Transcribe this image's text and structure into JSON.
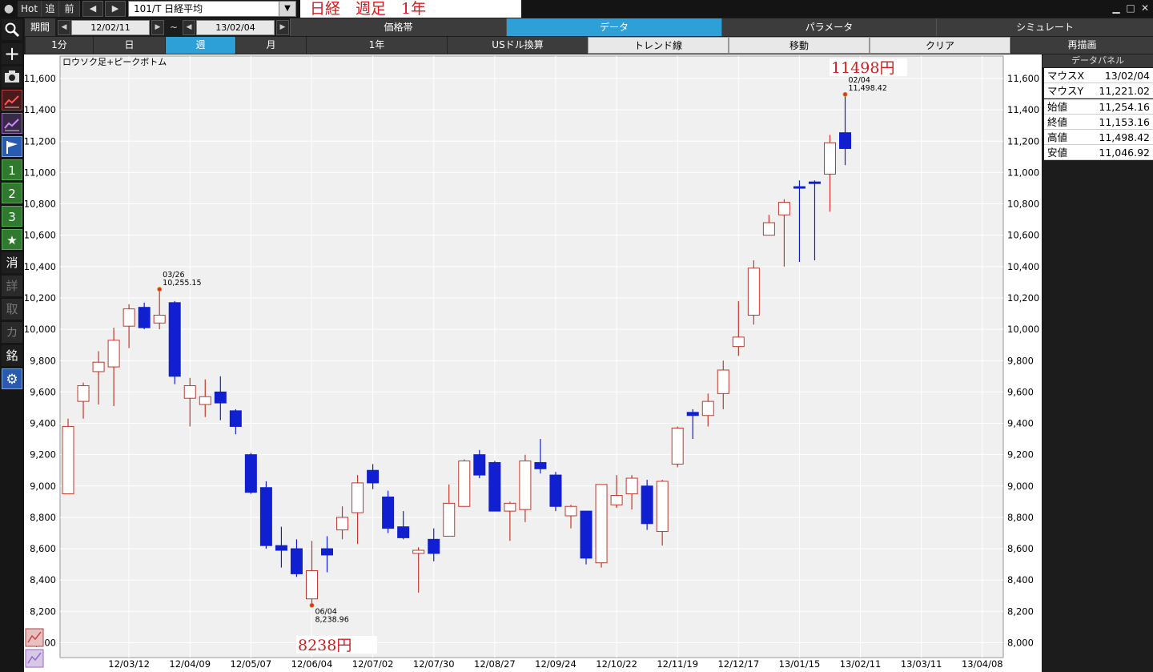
{
  "titlebar": {
    "hot": "Hot",
    "next": "追",
    "prev": "前",
    "symbol": "101/T 日経平均",
    "headline": "日経　週足　1年"
  },
  "toolbar_left": [
    "1",
    "2",
    "3",
    "★",
    "消",
    "詳",
    "取",
    "カ",
    "銘"
  ],
  "period": {
    "label": "期間",
    "start": "12/02/11",
    "tilde": "~",
    "end": "13/02/04",
    "tabs": [
      "価格帯",
      "データ",
      "パラメータ",
      "シミュレート"
    ],
    "selected_tab": "データ"
  },
  "timeframes": {
    "items": [
      "1分",
      "日",
      "週",
      "月",
      "1年",
      "USドル換算",
      "トレンド線",
      "移動",
      "クリア",
      "再描画"
    ],
    "selected": "週"
  },
  "chart_data": {
    "type": "candlestick",
    "title": "ロウソク足+ピークボトム",
    "ylim": [
      7920,
      11800
    ],
    "y_ticks": [
      8000,
      8200,
      8400,
      8600,
      8800,
      9000,
      9200,
      9400,
      9600,
      9800,
      10000,
      10200,
      10400,
      10600,
      10800,
      11000,
      11200,
      11400,
      11600
    ],
    "y_tick_labels": [
      "8,000",
      "8,200",
      "8,400",
      "8,600",
      "8,800",
      "9,000",
      "9,200",
      "9,400",
      "9,600",
      "9,800",
      "10,000",
      "10,200",
      "10,400",
      "10,600",
      "10,800",
      "11,000",
      "11,200",
      "11,400",
      "11,600"
    ],
    "x_ticks": [
      {
        "label": "12/03/12",
        "index": 4
      },
      {
        "label": "12/04/09",
        "index": 8
      },
      {
        "label": "12/05/07",
        "index": 12
      },
      {
        "label": "12/06/04",
        "index": 16
      },
      {
        "label": "12/07/02",
        "index": 20
      },
      {
        "label": "12/07/30",
        "index": 24
      },
      {
        "label": "12/08/27",
        "index": 28
      },
      {
        "label": "12/09/24",
        "index": 32
      },
      {
        "label": "12/10/22",
        "index": 36
      },
      {
        "label": "12/11/19",
        "index": 40
      },
      {
        "label": "12/12/17",
        "index": 44
      },
      {
        "label": "13/01/15",
        "index": 48
      },
      {
        "label": "13/02/11",
        "index": 52
      },
      {
        "label": "13/03/11",
        "index": 56
      },
      {
        "label": "13/04/08",
        "index": 60
      }
    ],
    "bull_color": "#c0392b",
    "bear_color": "#1020d0",
    "candles": [
      {
        "o": 8950,
        "h": 9430,
        "l": 8950,
        "c": 9380
      },
      {
        "o": 9540,
        "h": 9660,
        "l": 9430,
        "c": 9640
      },
      {
        "o": 9730,
        "h": 9860,
        "l": 9520,
        "c": 9790
      },
      {
        "o": 9760,
        "h": 10010,
        "l": 9510,
        "c": 9930
      },
      {
        "o": 10020,
        "h": 10160,
        "l": 9880,
        "c": 10130
      },
      {
        "o": 10140,
        "h": 10170,
        "l": 10000,
        "c": 10010
      },
      {
        "o": 10040,
        "h": 10255.15,
        "l": 10000,
        "c": 10090
      },
      {
        "o": 10170,
        "h": 10180,
        "l": 9650,
        "c": 9700
      },
      {
        "o": 9560,
        "h": 9690,
        "l": 9380,
        "c": 9640
      },
      {
        "o": 9520,
        "h": 9680,
        "l": 9440,
        "c": 9570
      },
      {
        "o": 9600,
        "h": 9700,
        "l": 9420,
        "c": 9530
      },
      {
        "o": 9480,
        "h": 9490,
        "l": 9330,
        "c": 9380
      },
      {
        "o": 9200,
        "h": 9210,
        "l": 8950,
        "c": 8960
      },
      {
        "o": 8990,
        "h": 9030,
        "l": 8600,
        "c": 8620
      },
      {
        "o": 8620,
        "h": 8740,
        "l": 8480,
        "c": 8590
      },
      {
        "o": 8600,
        "h": 8660,
        "l": 8420,
        "c": 8440
      },
      {
        "o": 8280,
        "h": 8650,
        "l": 8238.96,
        "c": 8460
      },
      {
        "o": 8600,
        "h": 8680,
        "l": 8450,
        "c": 8560
      },
      {
        "o": 8720,
        "h": 8870,
        "l": 8660,
        "c": 8800
      },
      {
        "o": 8830,
        "h": 9070,
        "l": 8630,
        "c": 9020
      },
      {
        "o": 9100,
        "h": 9140,
        "l": 8980,
        "c": 9020
      },
      {
        "o": 8930,
        "h": 8970,
        "l": 8700,
        "c": 8730
      },
      {
        "o": 8740,
        "h": 8840,
        "l": 8660,
        "c": 8670
      },
      {
        "o": 8570,
        "h": 8610,
        "l": 8320,
        "c": 8590
      },
      {
        "o": 8660,
        "h": 8730,
        "l": 8520,
        "c": 8570
      },
      {
        "o": 8680,
        "h": 9010,
        "l": 8680,
        "c": 8890
      },
      {
        "o": 8870,
        "h": 9170,
        "l": 8870,
        "c": 9160
      },
      {
        "o": 9200,
        "h": 9230,
        "l": 9050,
        "c": 9070
      },
      {
        "o": 9150,
        "h": 9160,
        "l": 8840,
        "c": 8840
      },
      {
        "o": 8840,
        "h": 8900,
        "l": 8650,
        "c": 8890
      },
      {
        "o": 8850,
        "h": 9200,
        "l": 8770,
        "c": 9160
      },
      {
        "o": 9150,
        "h": 9300,
        "l": 9080,
        "c": 9110
      },
      {
        "o": 9070,
        "h": 9090,
        "l": 8840,
        "c": 8870
      },
      {
        "o": 8810,
        "h": 8880,
        "l": 8730,
        "c": 8870
      },
      {
        "o": 8840,
        "h": 8840,
        "l": 8500,
        "c": 8540
      },
      {
        "o": 8510,
        "h": 9010,
        "l": 8480,
        "c": 9010
      },
      {
        "o": 8880,
        "h": 9070,
        "l": 8860,
        "c": 8940
      },
      {
        "o": 8950,
        "h": 9070,
        "l": 8850,
        "c": 9050
      },
      {
        "o": 9000,
        "h": 9040,
        "l": 8720,
        "c": 8760
      },
      {
        "o": 8710,
        "h": 9040,
        "l": 8620,
        "c": 9030
      },
      {
        "o": 9140,
        "h": 9380,
        "l": 9120,
        "c": 9370
      },
      {
        "o": 9470,
        "h": 9490,
        "l": 9300,
        "c": 9450
      },
      {
        "o": 9450,
        "h": 9590,
        "l": 9380,
        "c": 9540
      },
      {
        "o": 9590,
        "h": 9800,
        "l": 9490,
        "c": 9740
      },
      {
        "o": 9890,
        "h": 10180,
        "l": 9830,
        "c": 9950
      },
      {
        "o": 10090,
        "h": 10440,
        "l": 10030,
        "c": 10390
      },
      {
        "o": 10600,
        "h": 10730,
        "l": 10600,
        "c": 10680
      },
      {
        "o": 10730,
        "h": 10830,
        "l": 10400,
        "c": 10810
      },
      {
        "o": 10910,
        "h": 10950,
        "l": 10430,
        "c": 10900
      },
      {
        "o": 10940,
        "h": 10950,
        "l": 10440,
        "c": 10930
      },
      {
        "o": 10990,
        "h": 11240,
        "l": 10750,
        "c": 11190
      },
      {
        "o": 11254.16,
        "h": 11498.42,
        "l": 11046.92,
        "c": 11153.16
      }
    ],
    "peaks": [
      {
        "index": 6,
        "value": 10255.15,
        "date": "03/26",
        "label": "10,255.15",
        "type": "high"
      },
      {
        "index": 16,
        "value": 8238.96,
        "date": "06/04",
        "label": "8,238.96",
        "type": "low"
      },
      {
        "index": 51,
        "value": 11498.42,
        "date": "02/04",
        "label": "11,498.42",
        "type": "high"
      }
    ],
    "annotations": {
      "max": "11498円",
      "min": "8238円"
    }
  },
  "data_panel": {
    "title": "データパネル",
    "mouse": [
      {
        "k": "マウスX",
        "v": "13/02/04"
      },
      {
        "k": "マウスY",
        "v": "11,221.02"
      }
    ],
    "ohlc": [
      {
        "k": "始値",
        "v": "11,254.16"
      },
      {
        "k": "終値",
        "v": "11,153.16"
      },
      {
        "k": "高値",
        "v": "11,498.42"
      },
      {
        "k": "安値",
        "v": "11,046.92"
      }
    ]
  }
}
